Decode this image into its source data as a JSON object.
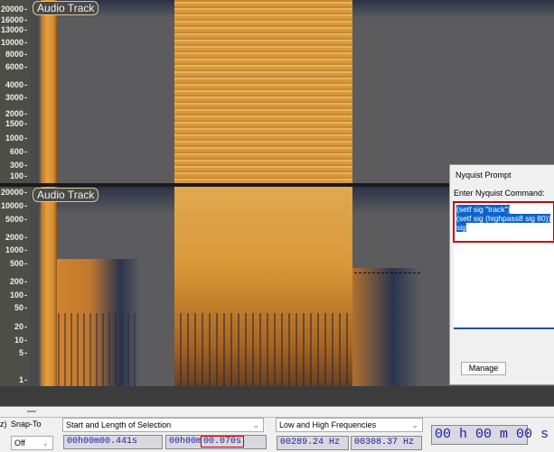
{
  "tracks": [
    {
      "label": "Audio Track",
      "scale": [
        "20000",
        "16000",
        "13000",
        "10000",
        "8000",
        "6000",
        "4000",
        "3000",
        "2000",
        "1500",
        "1000",
        "600",
        "300",
        "100"
      ]
    },
    {
      "label": "Audio Track",
      "scale": [
        "20000",
        "10000",
        "5000",
        "2000",
        "1000",
        "500",
        "200",
        "100",
        "50",
        "20",
        "10",
        "5",
        "1"
      ]
    }
  ],
  "dialog": {
    "title": "Nyquist Prompt",
    "prompt_label": "Enter Nyquist Command:",
    "command_lines": [
      "(setf sig \"track\")",
      "(setf sig (highpass8 sig 80))",
      "sig"
    ],
    "manage_label": "Manage"
  },
  "toolbar": {
    "rate_fragment": "z)",
    "snap_label": "Snap-To",
    "snap_value": "Off",
    "selection_mode": "Start and Length of Selection",
    "start": "00h00m00.441s",
    "length_prefix": "00h00m",
    "length_value": "00.070s",
    "freq_mode": "Low and High Frequencies",
    "low_freq": "00289.24 Hz",
    "high_freq": "00308.37 Hz",
    "audio_position": "00 h 00 m 00 s"
  }
}
